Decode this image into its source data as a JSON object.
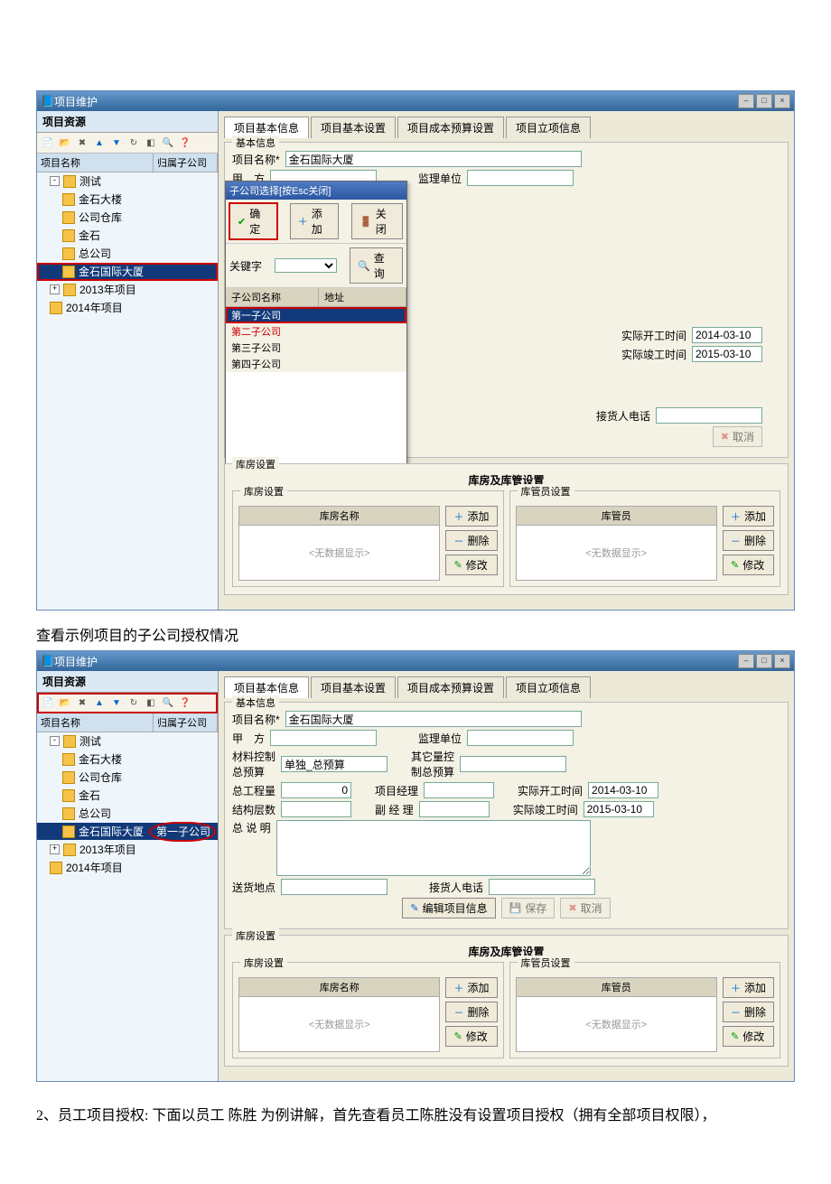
{
  "caption1": "查看示例项目的子公司授权情况",
  "bodytext": "2、员工项目授权:  下面以员工 陈胜 为例讲解，首先查看员工陈胜没有设置项目授权（拥有全部项目权限），",
  "window_title": "项目维护",
  "left": {
    "title": "项目资源",
    "col_name": "项目名称",
    "col_sub": "归属子公司"
  },
  "tree1": [
    {
      "indent": 0,
      "exp": "-",
      "label": "测试"
    },
    {
      "indent": 1,
      "label": "金石大楼"
    },
    {
      "indent": 1,
      "label": "公司仓库"
    },
    {
      "indent": 1,
      "label": "金石"
    },
    {
      "indent": 1,
      "label": "总公司"
    },
    {
      "indent": 1,
      "label": "金石国际大厦",
      "sel": true,
      "hl": true
    },
    {
      "indent": 0,
      "exp": "+",
      "label": "2013年项目"
    },
    {
      "indent": 0,
      "label": "2014年项目"
    }
  ],
  "tree2": [
    {
      "indent": 0,
      "exp": "-",
      "label": "测试"
    },
    {
      "indent": 1,
      "label": "金石大楼"
    },
    {
      "indent": 1,
      "label": "公司仓库"
    },
    {
      "indent": 1,
      "label": "金石"
    },
    {
      "indent": 1,
      "label": "总公司"
    },
    {
      "indent": 1,
      "label": "金石国际大厦",
      "sel": true,
      "sub": "第一子公司",
      "circ": true
    },
    {
      "indent": 0,
      "exp": "+",
      "label": "2013年项目"
    },
    {
      "indent": 0,
      "label": "2014年项目"
    }
  ],
  "tabs": {
    "t1": "项目基本信息",
    "t2": "项目基本设置",
    "t3": "项目成本预算设置",
    "t4": "项目立项信息"
  },
  "form": {
    "fs_title": "基本信息",
    "name_lbl": "项目名称*",
    "name_val": "金石国际大厦",
    "jia_lbl": "甲　方",
    "jl_lbl": "监理单位",
    "ctrl_lbl": "材料控制\n总预算",
    "ctrl_val": "单独_总预算",
    "other_lbl": "其它量控\n制总预算",
    "qty_lbl": "总工程量",
    "qty_val": "0",
    "pm_lbl": "项目经理",
    "start_lbl": "实际开工时间",
    "start_val": "2014-03-10",
    "floor_lbl": "结构层数",
    "vpm_lbl": "副 经 理",
    "end_lbl": "实际竣工时间",
    "end_val": "2015-03-10",
    "desc_lbl": "总 说 明",
    "addr_lbl": "送货地点",
    "phone_lbl": "接货人电话",
    "edit_btn": "编辑项目信息",
    "save_btn": "保存",
    "cancel_btn": "取消"
  },
  "popup": {
    "title": "子公司选择[按Esc关闭]",
    "ok": "确定",
    "add": "添加",
    "close": "关闭",
    "key_lbl": "关键字",
    "search": "查询",
    "col_name": "子公司名称",
    "col_addr": "地址",
    "rows": [
      "第一子公司",
      "第二子公司",
      "第三子公司",
      "第四子公司"
    ]
  },
  "store": {
    "section": "库房设置",
    "wide": "库房及库管设置",
    "panel1": "库房设置",
    "panel2": "库管员设置",
    "col1": "库房名称",
    "col2": "库管员",
    "add": "添加",
    "del": "删除",
    "mod": "修改",
    "empty": "<无数据显示>"
  }
}
